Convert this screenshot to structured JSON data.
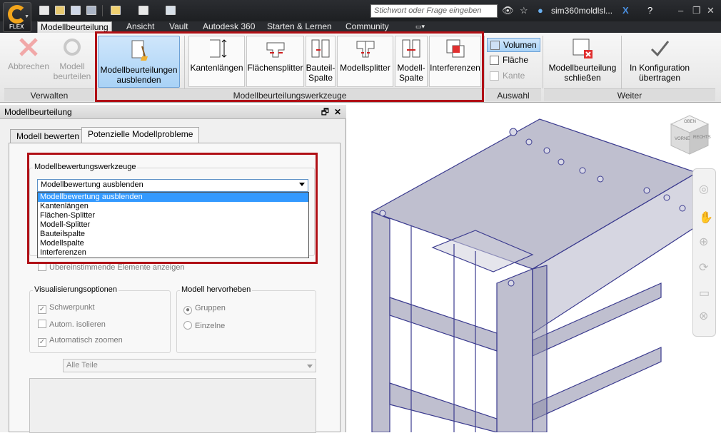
{
  "app": {
    "logo_text": "FLEX"
  },
  "search": {
    "placeholder": "Stichwort oder Frage eingeben"
  },
  "user": {
    "name": "sim360moldlsl..."
  },
  "tabs": [
    "Modellbeurteilung",
    "Ansicht",
    "Vault",
    "Autodesk 360",
    "Starten & Lernen",
    "Community"
  ],
  "ribbon": {
    "verwalten": {
      "label": "Verwalten",
      "abbrechen": "Abbrechen",
      "modell_beurteilen_1": "Modell",
      "modell_beurteilen_2": "beurteilen"
    },
    "tools": {
      "label": "Modellbeurteilungswerkzeuge",
      "ausblenden_1": "Modellbeurteilungen",
      "ausblenden_2": "ausblenden",
      "kantenlaengen": "Kantenlängen",
      "flaechensplitter": "Flächensplitter",
      "bauteilspalte_1": "Bauteil-",
      "bauteilspalte_2": "Spalte",
      "modellsplitter": "Modellsplitter",
      "modellspalte_1": "Modell-",
      "modellspalte_2": "Spalte",
      "interferenzen": "Interferenzen"
    },
    "auswahl": {
      "label": "Auswahl",
      "volumen": "Volumen",
      "flaeche": "Fläche",
      "kante": "Kante"
    },
    "weiter": {
      "label": "Weiter",
      "schliessen_1": "Modellbeurteilung",
      "schliessen_2": "schließen",
      "uebertragen_1": "In Konfiguration",
      "uebertragen_2": "übertragen"
    }
  },
  "panel": {
    "title": "Modellbeurteilung",
    "tab1": "Modell bewerten",
    "tab2": "Potenzielle Modellprobleme",
    "tools_group": "Modellbewertungswerkzeuge",
    "combo_value": "Modellbewertung ausblenden",
    "dropdown_options": [
      "Modellbewertung ausblenden",
      "Kantenlängen",
      "Flächen-Splitter",
      "Modell-Splitter",
      "Bauteilspalte",
      "Modellspalte",
      "Interferenzen"
    ],
    "match_checkbox": "Übereinstimmende Elemente anzeigen",
    "vis_group": "Visualisierungsoptionen",
    "schwerpunkt": "Schwerpunkt",
    "isolieren": "Autom. isolieren",
    "zoomen": "Automatisch zoomen",
    "highlight_group": "Modell hervorheben",
    "gruppen": "Gruppen",
    "einzelne": "Einzelne",
    "filter_value": "Alle Teile"
  },
  "viewcube": {
    "top": "OBEN",
    "front": "VORNE",
    "right": "RECHTS"
  }
}
